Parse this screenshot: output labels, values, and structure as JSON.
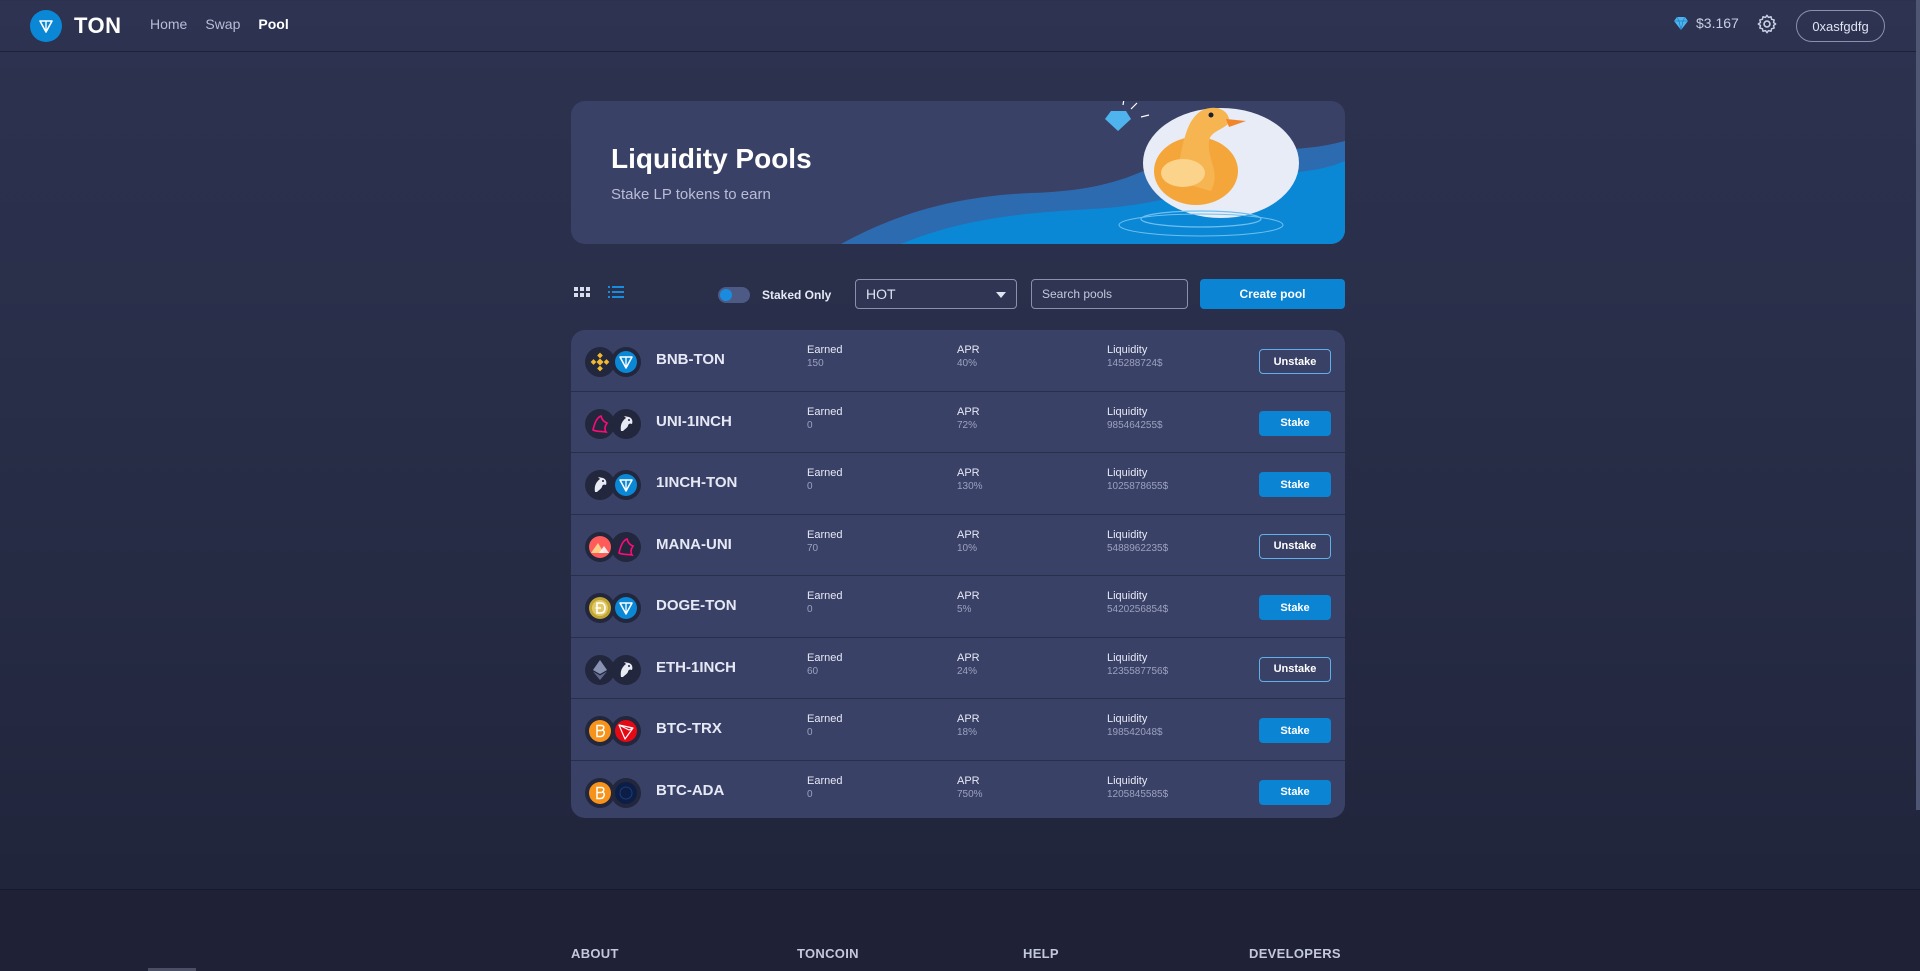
{
  "header": {
    "brand": "TON",
    "nav": [
      {
        "label": "Home",
        "active": false
      },
      {
        "label": "Swap",
        "active": false
      },
      {
        "label": "Pool",
        "active": true
      }
    ],
    "price": "$3.167",
    "wallet": "0xasfgdfg"
  },
  "banner": {
    "title": "Liquidity Pools",
    "subtitle": "Stake LP tokens to earn"
  },
  "controls": {
    "staked_only_label": "Staked Only",
    "sort_value": "HOT",
    "search_placeholder": "Search pools",
    "create_label": "Create pool"
  },
  "labels": {
    "earned": "Earned",
    "apr": "APR",
    "liquidity": "Liquidity"
  },
  "pools": [
    {
      "pair": "BNB-TON",
      "earned": "150",
      "apr": "40%",
      "liquidity": "145288724$",
      "action": "Unstake",
      "coin_a": "bnb",
      "coin_b": "ton"
    },
    {
      "pair": "UNI-1INCH",
      "earned": "0",
      "apr": "72%",
      "liquidity": "985464255$",
      "action": "Stake",
      "coin_a": "uni",
      "coin_b": "1inch"
    },
    {
      "pair": "1INCH-TON",
      "earned": "0",
      "apr": "130%",
      "liquidity": "1025878655$",
      "action": "Stake",
      "coin_a": "1inch",
      "coin_b": "ton"
    },
    {
      "pair": "MANA-UNI",
      "earned": "70",
      "apr": "10%",
      "liquidity": "5488962235$",
      "action": "Unstake",
      "coin_a": "mana",
      "coin_b": "uni"
    },
    {
      "pair": "DOGE-TON",
      "earned": "0",
      "apr": "5%",
      "liquidity": "5420256854$",
      "action": "Stake",
      "coin_a": "doge",
      "coin_b": "ton"
    },
    {
      "pair": "ETH-1INCH",
      "earned": "60",
      "apr": "24%",
      "liquidity": "1235587756$",
      "action": "Unstake",
      "coin_a": "eth",
      "coin_b": "1inch"
    },
    {
      "pair": "BTC-TRX",
      "earned": "0",
      "apr": "18%",
      "liquidity": "198542048$",
      "action": "Stake",
      "coin_a": "btc",
      "coin_b": "trx"
    },
    {
      "pair": "BTC-ADA",
      "earned": "0",
      "apr": "750%",
      "liquidity": "1205845585$",
      "action": "Stake",
      "coin_a": "btc",
      "coin_b": "ada"
    }
  ],
  "footer": {
    "columns": [
      "ABOUT",
      "TONCOIN",
      "HELP",
      "DEVELOPERS"
    ]
  },
  "colors": {
    "accent": "#0b84d4",
    "background": "#2d3350",
    "card": "#3a4166"
  }
}
